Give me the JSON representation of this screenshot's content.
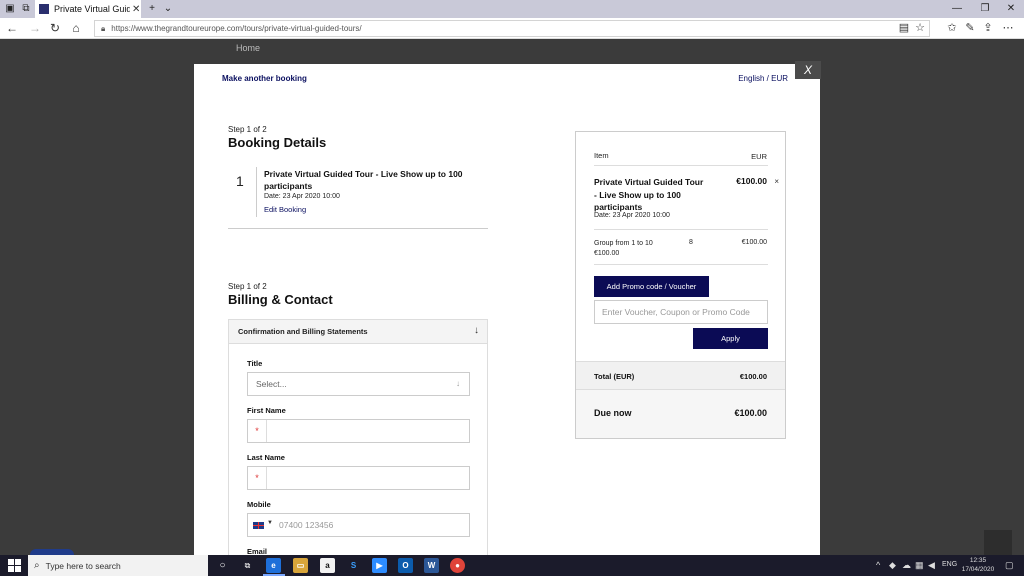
{
  "browser": {
    "tab_title": "Private Virtual Guided T",
    "url": "https://www.thegrandtoureurope.com/tours/private-virtual-guided-tours/"
  },
  "page": {
    "home_link": "Home"
  },
  "modal": {
    "close_label": "X",
    "another_booking": "Make another booking",
    "language_currency": "English / EUR",
    "booking": {
      "step": "Step 1 of 2",
      "heading": "Booking Details",
      "number": "1",
      "title": "Private Virtual Guided Tour - Live Show up to 100 participants",
      "date": "Date: 23 Apr 2020 10:00",
      "edit_label": "Edit Booking"
    },
    "billing": {
      "step": "Step 1 of 2",
      "heading": "Billing & Contact",
      "accordion_title": "Confirmation and Billing Statements",
      "accordion_arrow": "↓",
      "title_label": "Title",
      "title_placeholder": "Select...",
      "first_name_label": "First Name",
      "last_name_label": "Last Name",
      "mobile_label": "Mobile",
      "mobile_placeholder": "07400 123456",
      "email_label": "Email",
      "required_marker": "*"
    },
    "summary": {
      "item_header": "Item",
      "currency_header": "EUR",
      "product_title": "Private Virtual Guided Tour - Live Show up to 100 participants",
      "product_price": "€100.00",
      "product_date": "Date: 23 Apr 2020 10:00",
      "remove_label": "×",
      "group_line": "Group from 1 to 10",
      "group_unit_price": "€100.00",
      "group_qty": "8",
      "group_price": "€100.00",
      "promo_button": "Add Promo code / Voucher",
      "voucher_placeholder": "Enter Voucher, Coupon or Promo Code",
      "apply_button": "Apply",
      "total_label": "Total (EUR)",
      "total_value": "€100.00",
      "due_label": "Due now",
      "due_value": "€100.00"
    }
  },
  "taskbar": {
    "search_placeholder": "Type here to search",
    "language": "ENG",
    "time": "12:35",
    "date": "17/04/2020"
  },
  "colors": {
    "brand_navy": "#0b0b55",
    "link_navy": "#0b1060"
  }
}
